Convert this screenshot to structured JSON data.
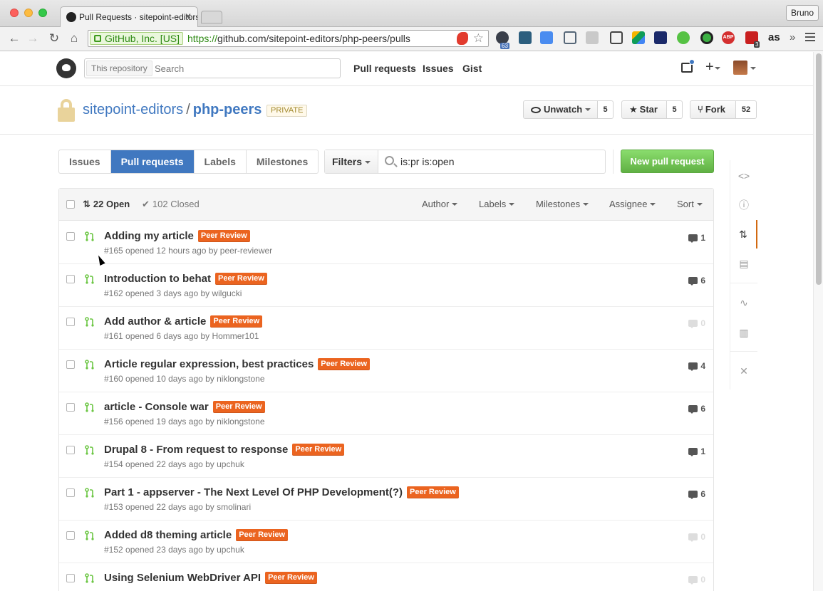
{
  "browser": {
    "tab_title": "Pull Requests · sitepoint-editors/php-peers",
    "profile_name": "Bruno",
    "ev_cert": "GitHub, Inc. [US]",
    "url_scheme": "https://",
    "url_rest": "github.com/sitepoint-editors/php-peers/pulls",
    "extension_badges": [
      "63",
      "3"
    ],
    "extension_text": "ABP",
    "lastfm": "as",
    "overflow": "»"
  },
  "github_header": {
    "search_scope": "This repository",
    "search_placeholder": "Search",
    "nav": [
      "Pull requests",
      "Issues",
      "Gist"
    ],
    "plus_icon": "+",
    "notification_color": "#4078c0"
  },
  "repo": {
    "owner": "sitepoint-editors",
    "separator": "/",
    "name": "php-peers",
    "visibility": "PRIVATE",
    "watch_label": "Unwatch",
    "watch_count": "5",
    "star_label": "Star",
    "star_count": "5",
    "fork_label": "Fork",
    "fork_count": "52"
  },
  "subnav": {
    "items": [
      "Issues",
      "Pull requests",
      "Labels",
      "Milestones"
    ],
    "active_index": 1,
    "filters_label": "Filters",
    "filter_query": "is:pr is:open",
    "new_pr_label": "New pull request"
  },
  "list_header": {
    "open_label": "22 Open",
    "closed_label": "102 Closed",
    "dropdowns": [
      "Author",
      "Labels",
      "Milestones",
      "Assignee",
      "Sort"
    ]
  },
  "pull_requests": [
    {
      "title": "Adding my article",
      "label": "Peer Review",
      "meta": "#165 opened 12 hours ago by peer-reviewer",
      "comments": "1"
    },
    {
      "title": "Introduction to behat",
      "label": "Peer Review",
      "meta": "#162 opened 3 days ago by wilgucki",
      "comments": "6"
    },
    {
      "title": "Add author & article",
      "label": "Peer Review",
      "meta": "#161 opened 6 days ago by Hommer101",
      "comments": "0"
    },
    {
      "title": "Article regular expression, best practices",
      "label": "Peer Review",
      "meta": "#160 opened 10 days ago by niklongstone",
      "comments": "4"
    },
    {
      "title": "article - Console war",
      "label": "Peer Review",
      "meta": "#156 opened 19 days ago by niklongstone",
      "comments": "6"
    },
    {
      "title": "Drupal 8 - From request to response",
      "label": "Peer Review",
      "meta": "#154 opened 22 days ago by upchuk",
      "comments": "1"
    },
    {
      "title": "Part 1 - appserver - The Next Level Of PHP Development(?)",
      "label": "Peer Review",
      "meta": "#153 opened 22 days ago by smolinari",
      "comments": "6"
    },
    {
      "title": "Added d8 theming article",
      "label": "Peer Review",
      "meta": "#152 opened 23 days ago by upchuk",
      "comments": "0"
    },
    {
      "title": "Using Selenium WebDriver API",
      "label": "Peer Review",
      "meta": "",
      "comments": "0"
    }
  ],
  "colors": {
    "accent_blue": "#4078c0",
    "label_orange": "#eb6420",
    "open_green": "#6cc644",
    "new_pr_green": "#60b044"
  }
}
